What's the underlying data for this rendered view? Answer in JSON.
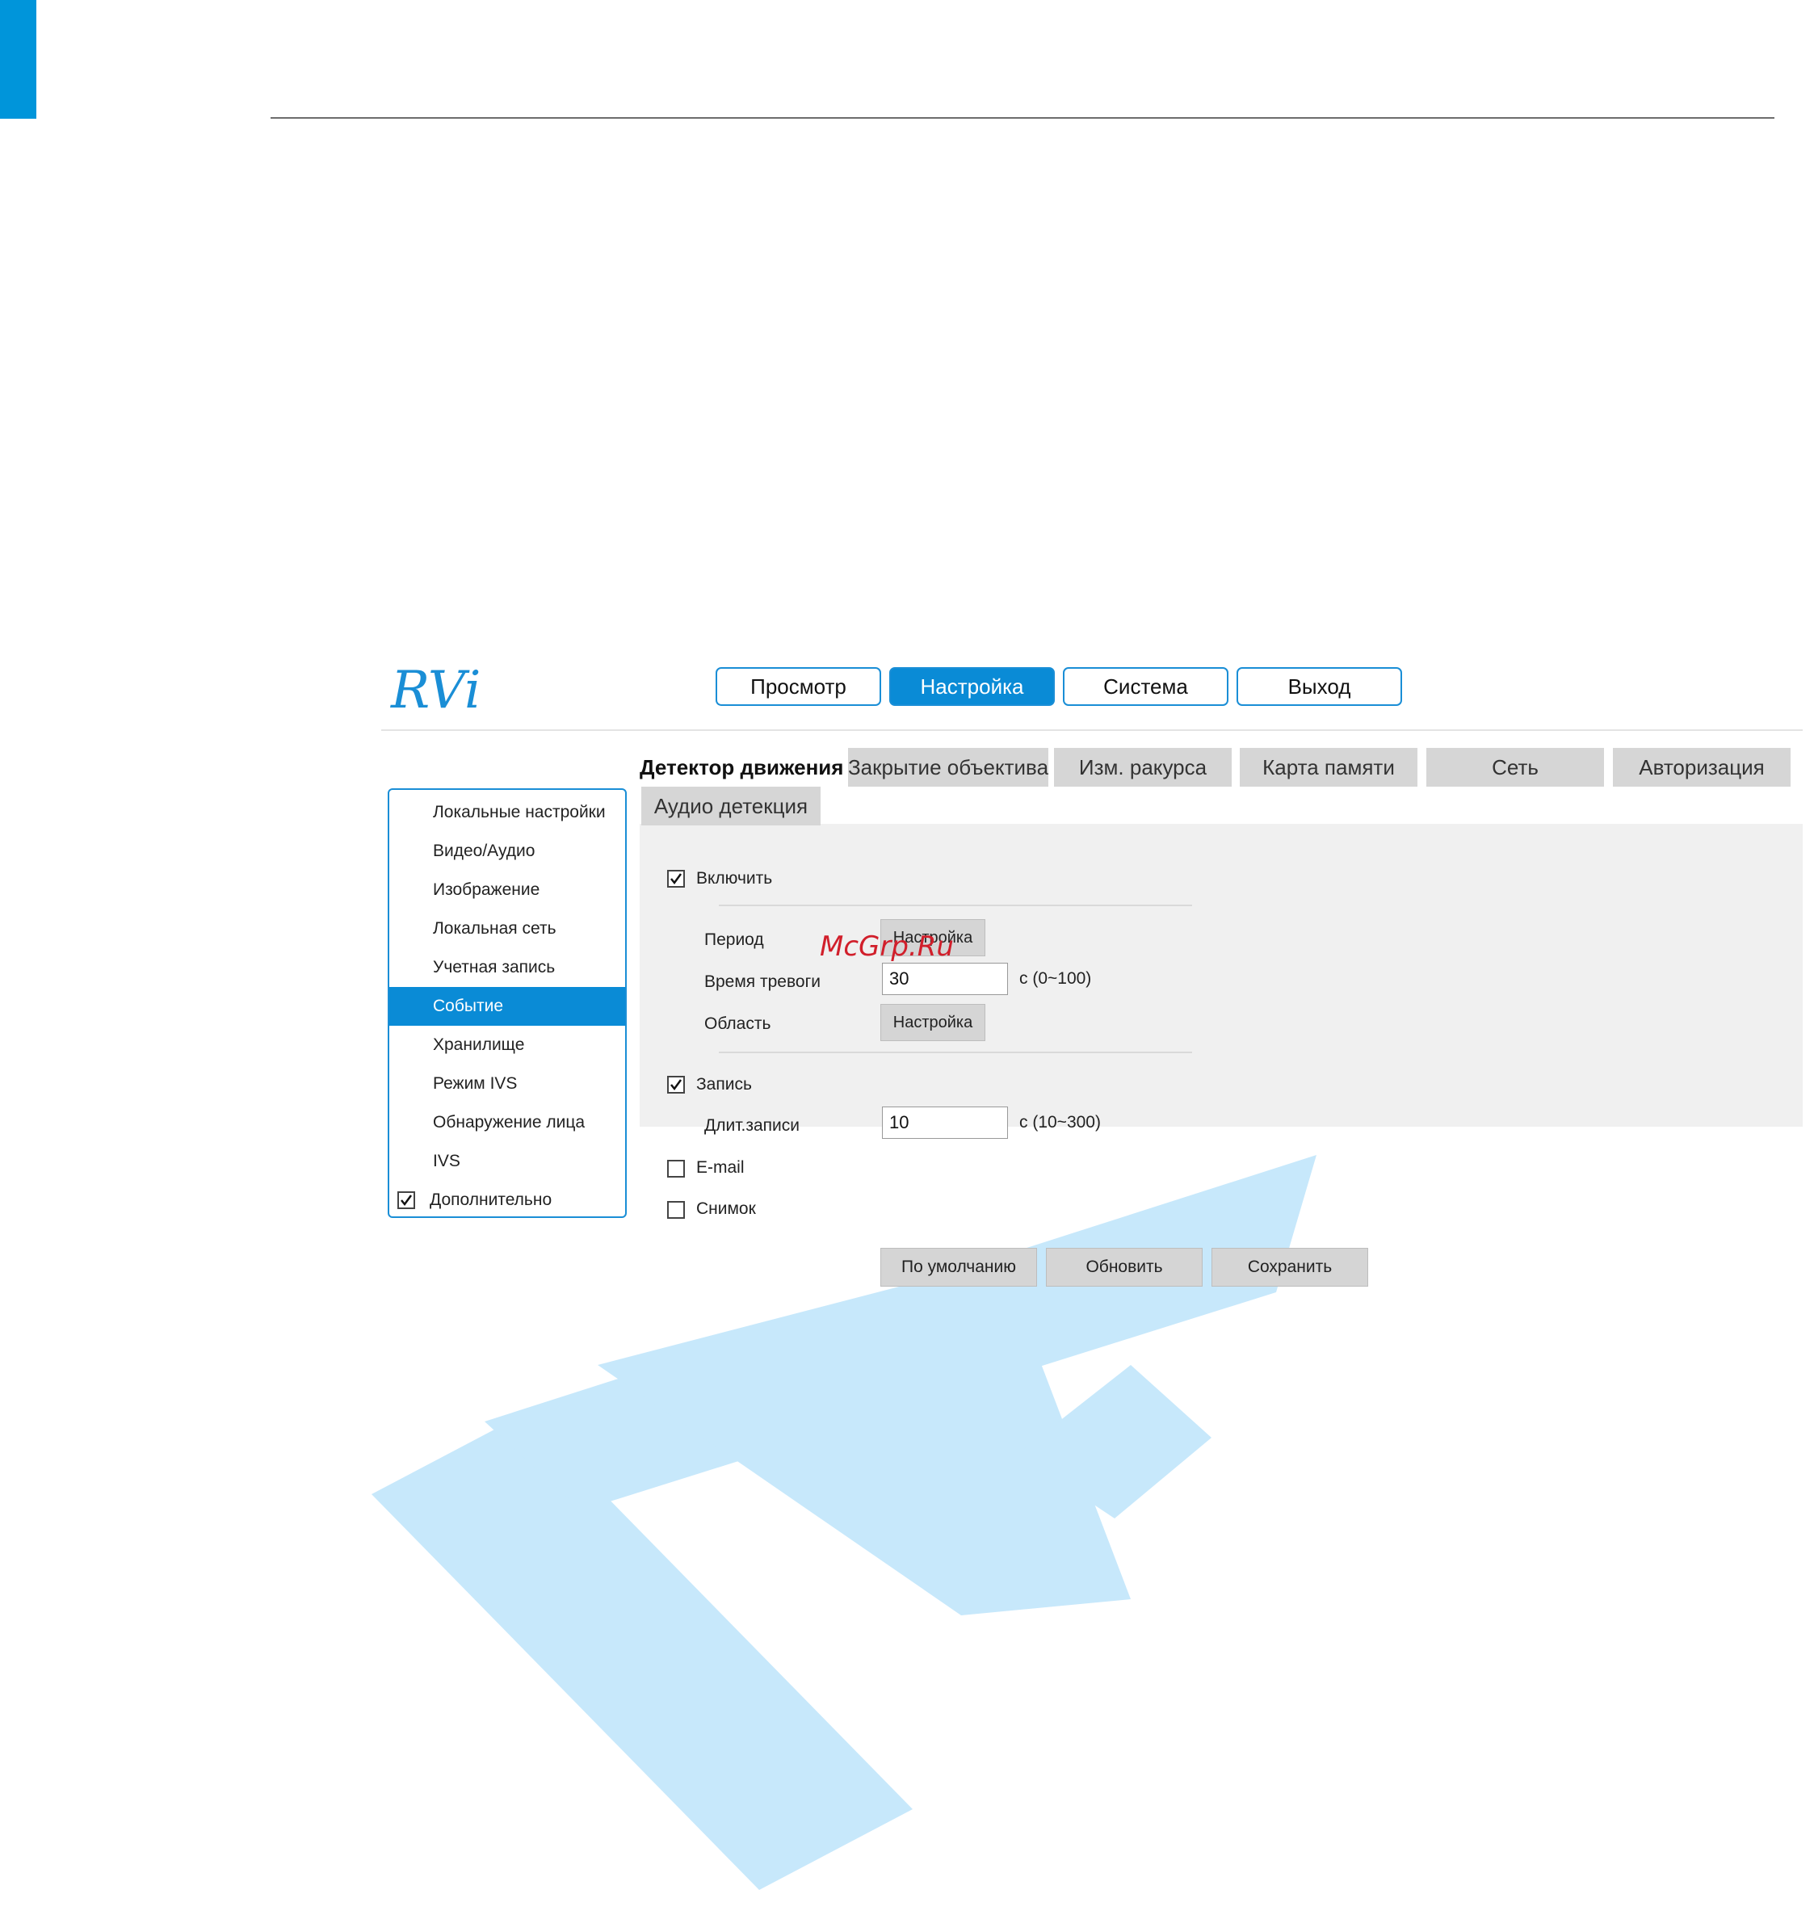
{
  "logo": {
    "text": "RVi"
  },
  "nav": {
    "items": [
      {
        "label": "Просмотр",
        "active": false
      },
      {
        "label": "Настройка",
        "active": true
      },
      {
        "label": "Система",
        "active": false
      },
      {
        "label": "Выход",
        "active": false
      }
    ]
  },
  "sidebar": {
    "items": [
      {
        "label": "Локальные настройки",
        "active": false
      },
      {
        "label": "Видео/Аудио",
        "active": false
      },
      {
        "label": "Изображение",
        "active": false
      },
      {
        "label": "Локальная сеть",
        "active": false
      },
      {
        "label": "Учетная запись",
        "active": false
      },
      {
        "label": "Событие",
        "active": true
      },
      {
        "label": "Хранилище",
        "active": false
      },
      {
        "label": "Режим IVS",
        "active": false
      },
      {
        "label": "Обнаружение лица",
        "active": false
      },
      {
        "label": "IVS",
        "active": false
      }
    ],
    "advanced": {
      "label": "Дополнительно",
      "checked": true
    }
  },
  "tabs": [
    {
      "label": "Детектор движения",
      "active": true
    },
    {
      "label": "Закрытие объектива",
      "active": false
    },
    {
      "label": "Изм. ракурса",
      "active": false
    },
    {
      "label": "Карта памяти",
      "active": false
    },
    {
      "label": "Сеть",
      "active": false
    },
    {
      "label": "Авторизация",
      "active": false
    },
    {
      "label": "Аудио детекция",
      "active": false
    }
  ],
  "form": {
    "enable": {
      "label": "Включить",
      "checked": true
    },
    "period": {
      "label": "Период",
      "button": "Настройка"
    },
    "alarm_time": {
      "label": "Время тревоги",
      "value": "30",
      "range": "с (0~100)"
    },
    "area": {
      "label": "Область",
      "button": "Настройка"
    },
    "record": {
      "label": "Запись",
      "checked": true
    },
    "record_duration": {
      "label": "Длит.записи",
      "value": "10",
      "range": "с (10~300)"
    },
    "email": {
      "label": "E-mail",
      "checked": false
    },
    "snapshot": {
      "label": "Снимок",
      "checked": false
    }
  },
  "actions": {
    "default": "По умолчанию",
    "refresh": "Обновить",
    "save": "Сохранить"
  },
  "overlay": {
    "text": "McGrp.Ru"
  }
}
